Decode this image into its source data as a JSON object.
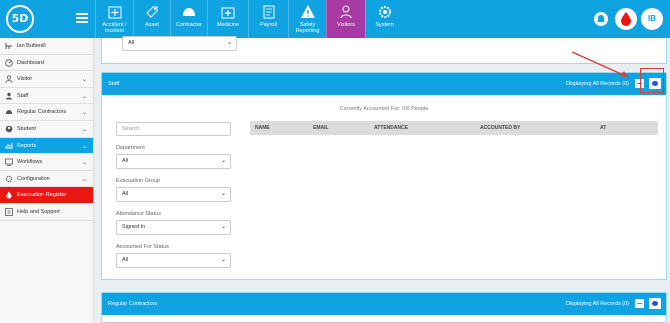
{
  "logo": {
    "text": "5D"
  },
  "nav": [
    {
      "label": "Accident /\nIncident",
      "icon": "first-aid-icon",
      "active": false
    },
    {
      "label": "Asset",
      "icon": "tag-icon",
      "active": false
    },
    {
      "label": "Contractor",
      "icon": "hardhat-icon",
      "active": false
    },
    {
      "label": "Medicine",
      "icon": "medkit-icon",
      "active": false
    },
    {
      "label": "Payroll",
      "icon": "document-icon",
      "active": false
    },
    {
      "label": "Safety\nReporting",
      "icon": "warning-icon",
      "active": false
    },
    {
      "label": "Visitors",
      "icon": "person-icon",
      "active": true
    },
    {
      "label": "System",
      "icon": "gear-icon",
      "active": false
    }
  ],
  "user": {
    "initials": "IB"
  },
  "sidebar": {
    "items": [
      {
        "label": "Ian Buttenill",
        "icon": "user-tree-icon",
        "chevron": false
      },
      {
        "label": "Dashboard",
        "icon": "dashboard-icon",
        "chevron": false
      },
      {
        "label": "Visitor",
        "icon": "visitor-icon",
        "chevron": true
      },
      {
        "label": "Staff",
        "icon": "staff-icon",
        "chevron": true
      },
      {
        "label": "Regular Contractors",
        "icon": "contractor-icon",
        "chevron": true
      },
      {
        "label": "Student",
        "icon": "student-icon",
        "chevron": true
      },
      {
        "label": "Reports",
        "icon": "reports-icon",
        "chevron": true
      },
      {
        "label": "Workflows",
        "icon": "workflow-icon",
        "chevron": true
      },
      {
        "label": "Configuration",
        "icon": "config-icon",
        "chevron": true
      },
      {
        "label": "Evacuation Register",
        "icon": "fire-icon",
        "chevron": false
      },
      {
        "label": "Help and Support",
        "icon": "help-icon",
        "chevron": false
      }
    ]
  },
  "top_select": {
    "value": "All"
  },
  "staff_panel": {
    "title": "Staff",
    "displaying": "Displaying All Records (0)",
    "accounted": "Currently Accounted For: 0/0 People",
    "search_placeholder": "Search",
    "filters": [
      {
        "label": "Department",
        "value": "All"
      },
      {
        "label": "Evacuation Group",
        "value": "All"
      },
      {
        "label": "Attendance Status",
        "value": "Signed In"
      },
      {
        "label": "Accounted For Status",
        "value": "All"
      }
    ],
    "columns": [
      "NAME",
      "EMAIL",
      "ATTENDANCE",
      "ACCOUNTED BY",
      "AT"
    ]
  },
  "contractors_panel": {
    "title": "Regular Contractors",
    "displaying": "Displaying All Records (0)"
  },
  "colors": {
    "brand": "#0fa3e2",
    "active_nav": "#a83aa3",
    "evac": "#e8170f"
  }
}
